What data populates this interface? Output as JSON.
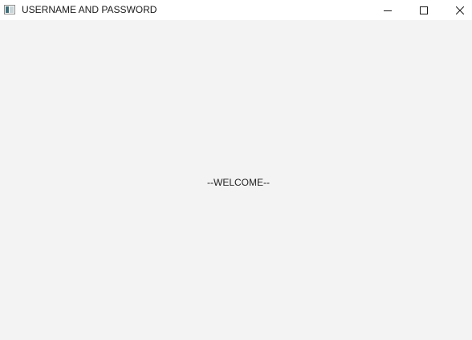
{
  "window": {
    "title": "USERNAME AND PASSWORD",
    "icon": "java-app-icon",
    "controls": {
      "minimize": "minimize-icon",
      "maximize": "maximize-icon",
      "close": "close-icon"
    }
  },
  "content": {
    "label": "--WELCOME--"
  },
  "colors": {
    "titlebar_bg": "#ffffff",
    "content_bg": "#f3f3f3",
    "text": "#222222"
  }
}
